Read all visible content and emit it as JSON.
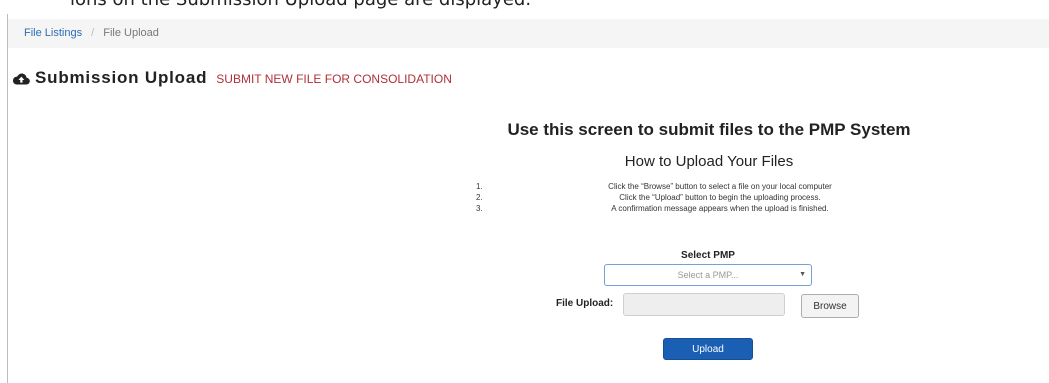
{
  "top_fragment": "ions on the Submission Upload page are displayed.",
  "breadcrumb": {
    "items": [
      "File Listings",
      "File Upload"
    ],
    "separator": "/"
  },
  "header": {
    "icon": "cloud-upload-icon",
    "title": "Submission Upload",
    "subtitle": "SUBMIT NEW FILE FOR CONSOLIDATION"
  },
  "intro": {
    "title": "Use this screen to submit files to the PMP System",
    "how_title": "How to Upload Your Files",
    "steps": [
      {
        "num": "1.",
        "text": "Click the “Browse” button to select a file on your local computer"
      },
      {
        "num": "2.",
        "text": "Click the “Upload” button to begin the uploading process."
      },
      {
        "num": "3.",
        "text": "A confirmation message appears when the upload is finished."
      }
    ]
  },
  "form": {
    "select_label": "Select PMP",
    "select_placeholder": "Select a PMP...",
    "file_label": "File Upload:",
    "file_value": "",
    "browse_label": "Browse",
    "upload_label": "Upload"
  },
  "colors": {
    "link": "#2a6db5",
    "subtitle": "#b0303a",
    "primary_button": "#1a5fb4",
    "breadcrumb_bg": "#f5f5f5"
  }
}
